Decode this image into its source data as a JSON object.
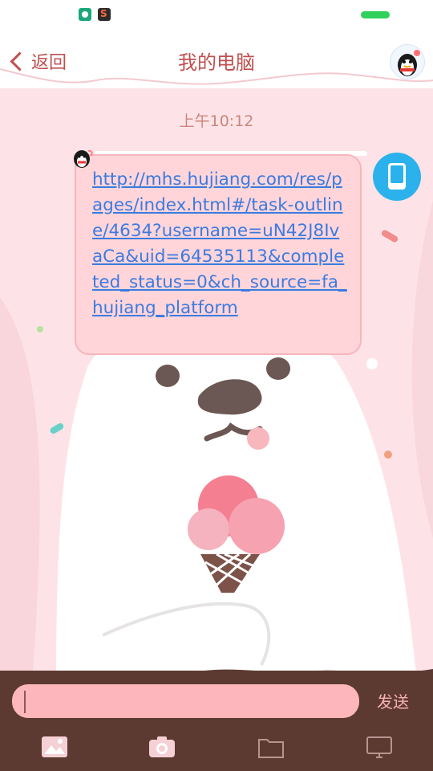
{
  "header": {
    "back_label": "返回",
    "title": "我的电脑"
  },
  "chat": {
    "timestamp": "上午10:12",
    "message_link": "http://mhs.hujiang.com/res/pages/index.html#/task-outline/4634?username=uN42J8IvaCa&uid=64535113&completed_status=0&ch_source=fa_hujiang_platform"
  },
  "composer": {
    "input_value": "",
    "send_label": "发送"
  },
  "toolbar": {
    "items": [
      "image-icon",
      "camera-icon",
      "folder-icon",
      "monitor-icon"
    ]
  },
  "colors": {
    "accent": "#c0504f",
    "link": "#3b7be0",
    "bubble": "#ffd5d9",
    "input": "#fdb7bc",
    "device_badge": "#2bb2ec",
    "toolbar_bg": "#5c3a31"
  }
}
